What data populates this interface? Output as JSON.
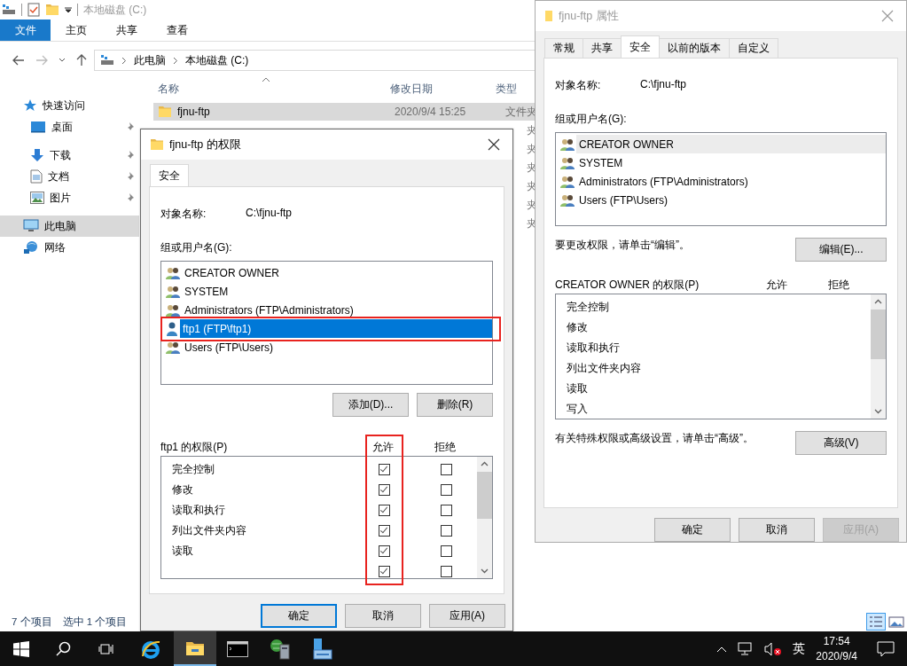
{
  "explorer": {
    "title": "本地磁盘 (C:)",
    "ribbon_tabs": [
      {
        "label": "文件",
        "selected": true
      },
      {
        "label": "主页",
        "selected": false
      },
      {
        "label": "共享",
        "selected": false
      },
      {
        "label": "查看",
        "selected": false
      }
    ],
    "breadcrumb": [
      "此电脑",
      "本地磁盘 (C:)"
    ],
    "nav": [
      {
        "label": "快速访问",
        "kind": "star",
        "selected": false,
        "children": [
          {
            "label": "桌面",
            "kind": "desktop",
            "pinned": true,
            "selected": false
          },
          {
            "label": "下载",
            "kind": "download",
            "pinned": true,
            "selected": false
          },
          {
            "label": "文档",
            "kind": "document",
            "pinned": true,
            "selected": false
          },
          {
            "label": "图片",
            "kind": "picture",
            "pinned": true,
            "selected": false
          }
        ]
      },
      {
        "label": "此电脑",
        "kind": "pc",
        "selected": true
      },
      {
        "label": "网络",
        "kind": "network",
        "selected": false
      }
    ],
    "columns": [
      "名称",
      "修改日期",
      "类型"
    ],
    "rows": [
      {
        "name": "fjnu-ftp",
        "date": "2020/9/4 15:25",
        "type": "文件夹",
        "selected": true
      },
      {
        "type": "夹",
        "selected": false
      },
      {
        "type": "夹",
        "selected": false
      },
      {
        "type": "夹",
        "selected": false
      },
      {
        "type": "夹",
        "selected": false
      },
      {
        "type": "夹",
        "selected": false
      },
      {
        "type": "夹",
        "selected": false
      }
    ],
    "status": [
      "7 个项目",
      "选中 1 个项目"
    ]
  },
  "permissions_dialog": {
    "title": "fjnu-ftp 的权限",
    "tab": "安全",
    "object_label": "对象名称:",
    "object_value": "C:\\fjnu-ftp",
    "groups_label": "组或用户名(G):",
    "groups": [
      {
        "name": "CREATOR OWNER",
        "kind": "group",
        "selected": false,
        "highlighted": false
      },
      {
        "name": "SYSTEM",
        "kind": "group",
        "selected": false,
        "highlighted": false
      },
      {
        "name": "Administrators (FTP\\Administrators)",
        "kind": "group",
        "selected": false,
        "highlighted": false
      },
      {
        "name": "ftp1 (FTP\\ftp1)",
        "kind": "user",
        "selected": true,
        "highlighted": true
      },
      {
        "name": "Users (FTP\\Users)",
        "kind": "group",
        "selected": false,
        "highlighted": false
      }
    ],
    "add_button": "添加(D)...",
    "remove_button": "删除(R)",
    "permissions_label": "ftp1 的权限(P)",
    "allow_header": "允许",
    "deny_header": "拒绝",
    "allow_column_highlighted": true,
    "permissions": [
      {
        "name": "完全控制",
        "allow": true,
        "deny": false
      },
      {
        "name": "修改",
        "allow": true,
        "deny": false
      },
      {
        "name": "读取和执行",
        "allow": true,
        "deny": false
      },
      {
        "name": "列出文件夹内容",
        "allow": true,
        "deny": false
      },
      {
        "name": "读取",
        "allow": true,
        "deny": false
      },
      {
        "allow": true,
        "deny": false
      }
    ],
    "buttons": [
      {
        "label": "确定",
        "default": true,
        "disabled": false
      },
      {
        "label": "取消",
        "default": false,
        "disabled": false
      },
      {
        "label": "应用(A)",
        "default": false,
        "disabled": false
      }
    ]
  },
  "properties_window": {
    "title": "fjnu-ftp 属性",
    "tabs": [
      {
        "label": "常规",
        "selected": false
      },
      {
        "label": "共享",
        "selected": false
      },
      {
        "label": "安全",
        "selected": true
      },
      {
        "label": "以前的版本",
        "selected": false
      },
      {
        "label": "自定义",
        "selected": false
      }
    ],
    "object_label": "对象名称:",
    "object_value": "C:\\fjnu-ftp",
    "groups_label": "组或用户名(G):",
    "groups": [
      {
        "name": "CREATOR OWNER",
        "kind": "group",
        "selected": true
      },
      {
        "name": "SYSTEM",
        "kind": "group",
        "selected": false
      },
      {
        "name": "Administrators (FTP\\Administrators)",
        "kind": "group",
        "selected": false
      },
      {
        "name": "Users (FTP\\Users)",
        "kind": "group",
        "selected": false
      }
    ],
    "edit_hint": "要更改权限，请单击“编辑”。",
    "edit_button": "编辑(E)...",
    "permissions_label": "CREATOR OWNER 的权限(P)",
    "allow_header": "允许",
    "deny_header": "拒绝",
    "permissions": [
      {
        "name": "完全控制"
      },
      {
        "name": "修改"
      },
      {
        "name": "读取和执行"
      },
      {
        "name": "列出文件夹内容"
      },
      {
        "name": "读取"
      },
      {
        "name": "写入"
      }
    ],
    "advanced_hint": "有关特殊权限或高级设置，请单击“高级”。",
    "advanced_button": "高级(V)",
    "buttons": [
      {
        "label": "确定",
        "default": false,
        "disabled": false
      },
      {
        "label": "取消",
        "default": false,
        "disabled": false
      },
      {
        "label": "应用(A)",
        "default": false,
        "disabled": true
      }
    ]
  },
  "taskbar": {
    "apps": [
      {
        "kind": "browser",
        "active": false
      },
      {
        "kind": "folder",
        "active": true
      },
      {
        "kind": "terminal",
        "active": false
      },
      {
        "kind": "server",
        "active": false
      },
      {
        "kind": "computer",
        "active": false
      }
    ],
    "ime": "英",
    "time": "17:54",
    "date": "2020/9/4"
  }
}
